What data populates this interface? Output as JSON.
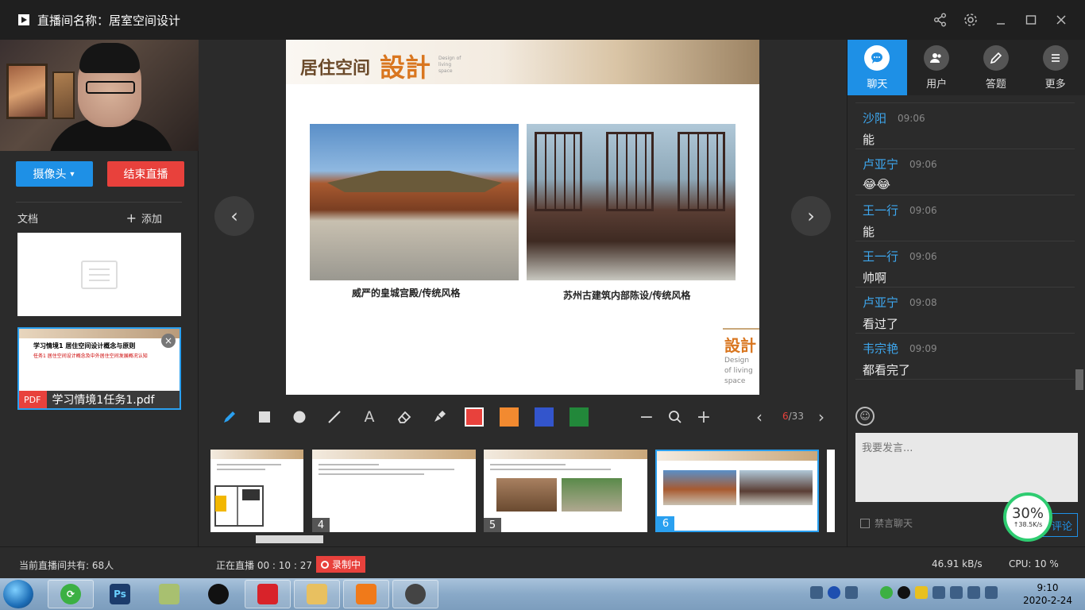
{
  "titlebar": {
    "label": "直播间名称：",
    "room_name": "居室空间设计"
  },
  "left": {
    "camera_button": "摄像头",
    "end_button": "结束直播",
    "docs_label": "文档",
    "add_label": "添加",
    "pdf": {
      "badge": "PDF",
      "filename": "学习情境1任务1.pdf",
      "thumb_heading": "学习情境1  居住空间设计概念与原则",
      "thumb_sub": "任务1  居住空间设计概念及中外居住空间发展概况认知"
    }
  },
  "slide": {
    "logo_cn": "居住空间",
    "logo_art": "設計",
    "logo_en": "Design of living space",
    "caption_left": "威严的皇城宫殿/传统风格",
    "caption_right": "苏州古建筑内部陈设/传统风格",
    "corner_art": "設計",
    "corner_en_1": "Design",
    "corner_en_2": "of living",
    "corner_en_3": "space"
  },
  "toolbar": {
    "colors": {
      "red": "#e8413c",
      "orange": "#f28a30",
      "blue": "#3355cc",
      "green": "#22883a"
    },
    "page_current": "6",
    "page_total": "/33"
  },
  "thumbnails": [
    {
      "num": ""
    },
    {
      "num": "4"
    },
    {
      "num": "5"
    },
    {
      "num": "6"
    }
  ],
  "right": {
    "tabs": [
      {
        "label": "聊天",
        "icon": "chat-icon"
      },
      {
        "label": "用户",
        "icon": "users-icon"
      },
      {
        "label": "答题",
        "icon": "pencil-icon"
      },
      {
        "label": "更多",
        "icon": "more-icon"
      }
    ],
    "messages": [
      {
        "user": "沙阳",
        "time": "09:06",
        "text": "能"
      },
      {
        "user": "卢亚宁",
        "time": "09:06",
        "text": "😂😂"
      },
      {
        "user": "王一行",
        "time": "09:06",
        "text": "能"
      },
      {
        "user": "王一行",
        "time": "09:06",
        "text": "帅啊"
      },
      {
        "user": "卢亚宁",
        "time": "09:08",
        "text": "看过了"
      },
      {
        "user": "韦宗艳",
        "time": "09:09",
        "text": "都看完了"
      }
    ],
    "input_placeholder": "我要发言...",
    "mute_label": "禁言聊天",
    "send_label": "评论",
    "gauge_value": "30%",
    "gauge_speed": "↑38.5K/s"
  },
  "status": {
    "online": "当前直播间共有: 68人",
    "live": "正在直播 00 : 10 : 27",
    "recording": "录制中",
    "net": "46.91 kB/s",
    "cpu": "CPU:  10 %"
  },
  "taskbar": {
    "time": "9:10",
    "date": "2020-2-24"
  }
}
